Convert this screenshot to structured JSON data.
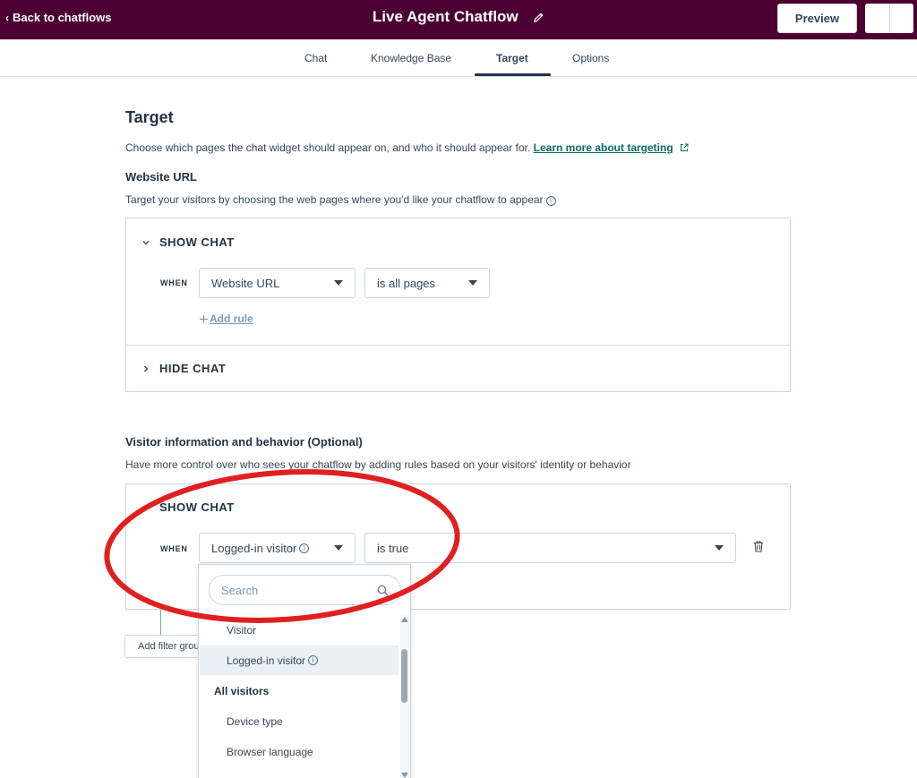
{
  "topbar": {
    "back_label": "Back to chatflows",
    "title": "Live Agent Chatflow",
    "preview_label": "Preview"
  },
  "tabs": [
    {
      "label": "Chat"
    },
    {
      "label": "Knowledge Base"
    },
    {
      "label": "Target",
      "active": true
    },
    {
      "label": "Options"
    }
  ],
  "page": {
    "title": "Target",
    "description": "Choose which pages the chat widget should appear on, and who it should appear for.",
    "learn_more": "Learn more about targeting"
  },
  "website_url": {
    "heading": "Website URL",
    "description": "Target your visitors by choosing the web pages where you'd like your chatflow to appear",
    "show_chat": {
      "label": "SHOW CHAT",
      "when": "WHEN",
      "property": "Website URL",
      "condition": "is all pages",
      "add_rule": "Add rule"
    },
    "hide_chat": {
      "label": "HIDE CHAT"
    }
  },
  "visitor_info": {
    "heading": "Visitor information and behavior (Optional)",
    "description": "Have more control over who sees your chatflow by adding rules based on your visitors' identity or behavior",
    "show_chat": {
      "label": "SHOW CHAT",
      "when": "WHEN",
      "property": "Logged-in visitor",
      "condition": "is true"
    },
    "add_filter_group": "Add filter group"
  },
  "dropdown": {
    "search_placeholder": "Search",
    "items": [
      {
        "label": "Visitor",
        "type": "option"
      },
      {
        "label": "Logged-in visitor",
        "type": "option",
        "selected": true,
        "info": true
      },
      {
        "label": "All visitors",
        "type": "group"
      },
      {
        "label": "Device type",
        "type": "option"
      },
      {
        "label": "Browser language",
        "type": "option"
      }
    ]
  },
  "colors": {
    "topbar": "#4b0031",
    "link": "#0c6a64",
    "annotation": "#e02020"
  }
}
